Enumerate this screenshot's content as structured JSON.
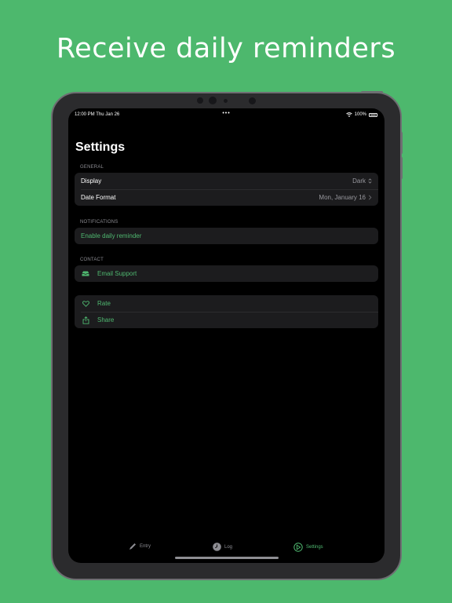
{
  "headline": "Receive daily reminders",
  "status_bar": {
    "time": "12:00 PM  Thu Jan 26",
    "battery": "100%"
  },
  "page_title": "Settings",
  "general": {
    "header": "GENERAL",
    "display_label": "Display",
    "display_value": "Dark",
    "date_format_label": "Date Format",
    "date_format_value": "Mon, January 16"
  },
  "notifications": {
    "header": "NOTIFICATIONS",
    "enable_label": "Enable daily reminder"
  },
  "contact": {
    "header": "CONTACT",
    "email_label": "Email Support"
  },
  "more": {
    "rate_label": "Rate",
    "share_label": "Share"
  },
  "tabs": {
    "entry": "Entry",
    "log": "Log",
    "settings": "Settings"
  },
  "colors": {
    "background": "#4db86d",
    "accent": "#4fb870",
    "cell": "#1c1c1e"
  }
}
